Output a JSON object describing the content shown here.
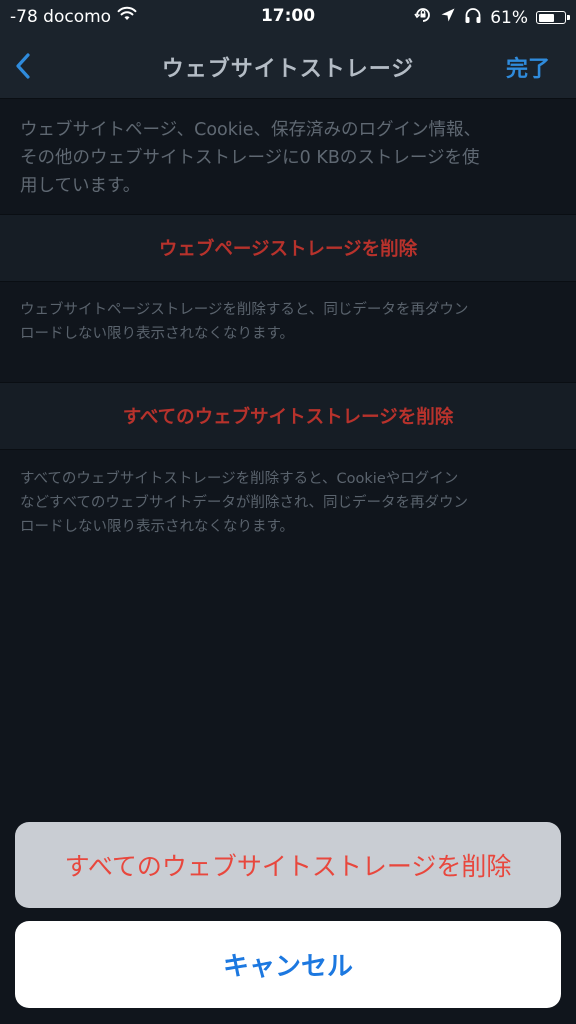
{
  "status_bar": {
    "carrier": "-78 docomo",
    "time": "17:00",
    "battery_percent": "61%",
    "battery_level": 0.61
  },
  "nav": {
    "back_icon": "chevron-left-icon",
    "title": "ウェブサイトストレージ",
    "done_label": "完了"
  },
  "storage_info": {
    "line1": "ウェブサイトページ、Cookie、保存済みのログイン情報、",
    "line2": "その他のウェブサイトストレージに0 KBのストレージを使",
    "line3": "用しています。"
  },
  "clear_webpage_storage": {
    "label": "ウェブページストレージを削除",
    "note_line1": "ウェブサイトページストレージを削除すると、同じデータを再ダウン",
    "note_line2": "ロードしない限り表示されなくなります。"
  },
  "clear_all_storage": {
    "label": "すべてのウェブサイトストレージを削除",
    "note_line1": "すべてのウェブサイトストレージを削除すると、Cookieやログイン",
    "note_line2": "などすべてのウェブサイトデータが削除され、同じデータを再ダウン",
    "note_line3": "ロードしない限り表示されなくなります。"
  },
  "action_sheet": {
    "destructive_label": "すべてのウェブサイトストレージを削除",
    "cancel_label": "キャンセル"
  },
  "colors": {
    "background": "#10151c",
    "accent": "#2f8bdc",
    "destructive": "#b7322c",
    "sheet_destructive": "#e8473d"
  }
}
